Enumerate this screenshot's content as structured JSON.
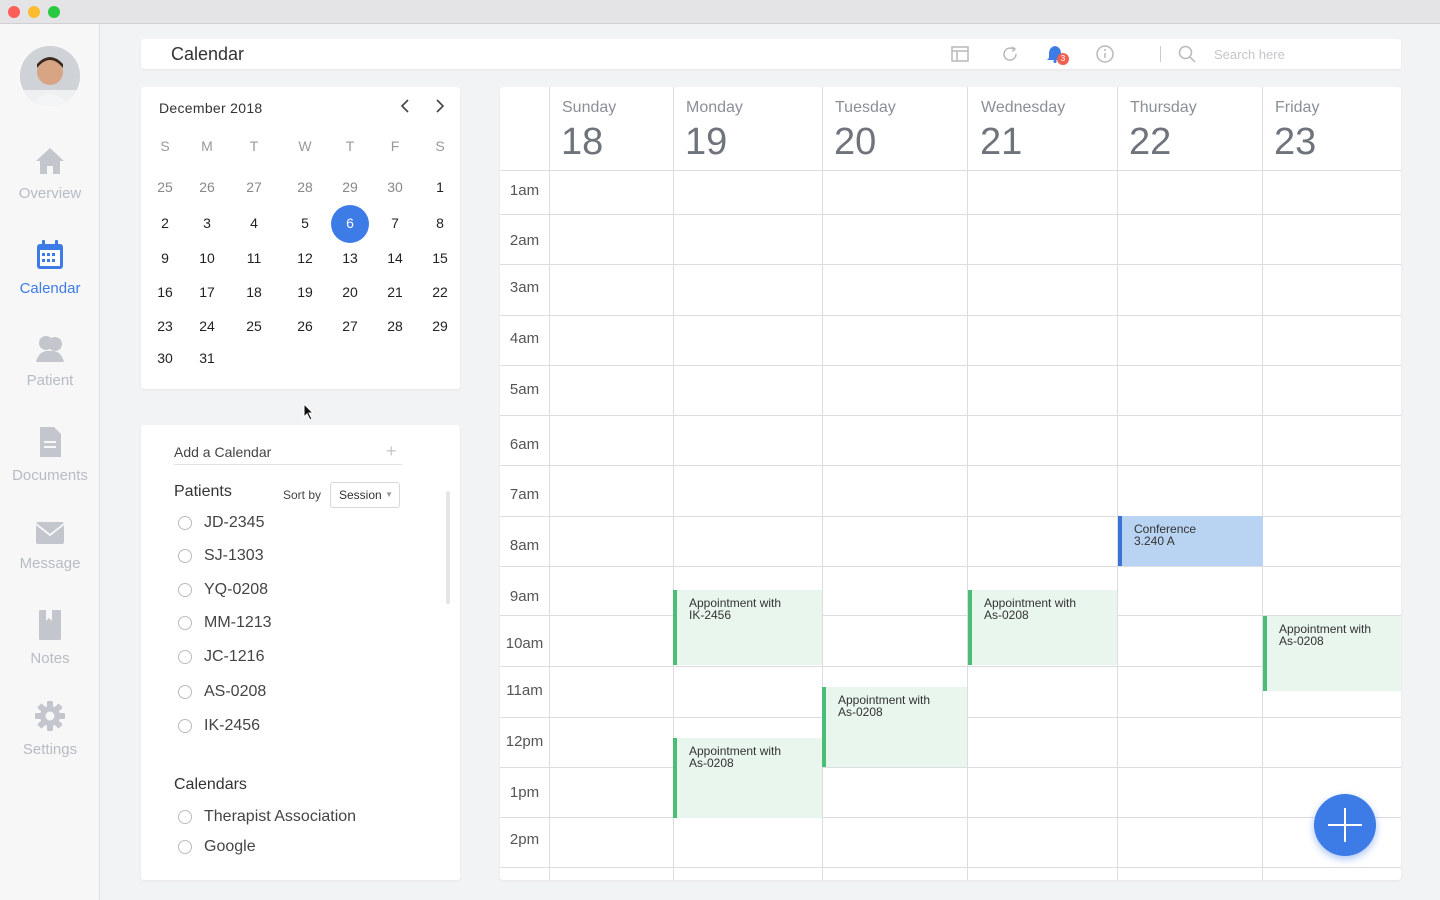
{
  "window": {
    "controls": [
      "close",
      "minimize",
      "zoom"
    ]
  },
  "sidebar": {
    "avatar_icon": "user-avatar",
    "items": [
      {
        "label": "Overview",
        "icon": "home-icon",
        "active": false
      },
      {
        "label": "Calendar",
        "icon": "calendar-icon",
        "active": true
      },
      {
        "label": "Patient",
        "icon": "people-icon",
        "active": false
      },
      {
        "label": "Documents",
        "icon": "document-icon",
        "active": false
      },
      {
        "label": "Message",
        "icon": "envelope-icon",
        "active": false
      },
      {
        "label": "Notes",
        "icon": "bookmark-icon",
        "active": false
      },
      {
        "label": "Settings",
        "icon": "gear-icon",
        "active": false
      }
    ]
  },
  "topbar": {
    "title": "Calendar",
    "notification_count": "3",
    "search_placeholder": "Search here"
  },
  "mini_calendar": {
    "month_label": "December 2018",
    "weekday_heads": [
      "S",
      "M",
      "T",
      "W",
      "T",
      "F",
      "S"
    ],
    "weeks": [
      [
        "25",
        "26",
        "27",
        "28",
        "29",
        "30",
        "1"
      ],
      [
        "2",
        "3",
        "4",
        "5",
        "6",
        "7",
        "8"
      ],
      [
        "9",
        "10",
        "11",
        "12",
        "13",
        "14",
        "15"
      ],
      [
        "16",
        "17",
        "18",
        "19",
        "20",
        "21",
        "22"
      ],
      [
        "23",
        "24",
        "25",
        "26",
        "27",
        "28",
        "29"
      ],
      [
        "30",
        "31",
        "",
        "",
        "",
        "",
        ""
      ]
    ],
    "selected_day": "6"
  },
  "filters": {
    "add_calendar_label": "Add a Calendar",
    "add_calendar_plus": "+",
    "patients_title": "Patients",
    "sort_by_label": "Sort by",
    "sort_value": "Session",
    "patients": [
      "JD-2345",
      "SJ-1303",
      "YQ-0208",
      "MM-1213",
      "JC-1216",
      "AS-0208",
      "IK-2456"
    ],
    "calendars_title": "Calendars",
    "calendars": [
      "Therapist Association",
      "Google"
    ]
  },
  "week": {
    "days": [
      {
        "name": "Sunday",
        "num": "18"
      },
      {
        "name": "Monday",
        "num": "19"
      },
      {
        "name": "Tuesday",
        "num": "20"
      },
      {
        "name": "Wednesday",
        "num": "21"
      },
      {
        "name": "Thursday",
        "num": "22"
      },
      {
        "name": "Friday",
        "num": "23"
      }
    ],
    "hours": [
      "1am",
      "2am",
      "3am",
      "4am",
      "5am",
      "6am",
      "7am",
      "8am",
      "9am",
      "10am",
      "11am",
      "12pm",
      "1pm",
      "2pm"
    ],
    "events": [
      {
        "line1": "Conference",
        "line2": "3.240 A",
        "color": "blue"
      },
      {
        "line1": "Appointment with",
        "line2": "IK-2456",
        "color": "green"
      },
      {
        "line1": "Appointment with",
        "line2": "As-0208",
        "color": "green"
      },
      {
        "line1": "Appointment with",
        "line2": "As-0208",
        "color": "green"
      },
      {
        "line1": "Appointment with",
        "line2": "As-0208",
        "color": "green"
      },
      {
        "line1": "Appointment with",
        "line2": "As-0208",
        "color": "green"
      }
    ]
  },
  "colors": {
    "accent": "#3d7be6",
    "event_green": "#4cbd77",
    "event_blue": "#3a72d6",
    "badge": "#f0604f"
  }
}
